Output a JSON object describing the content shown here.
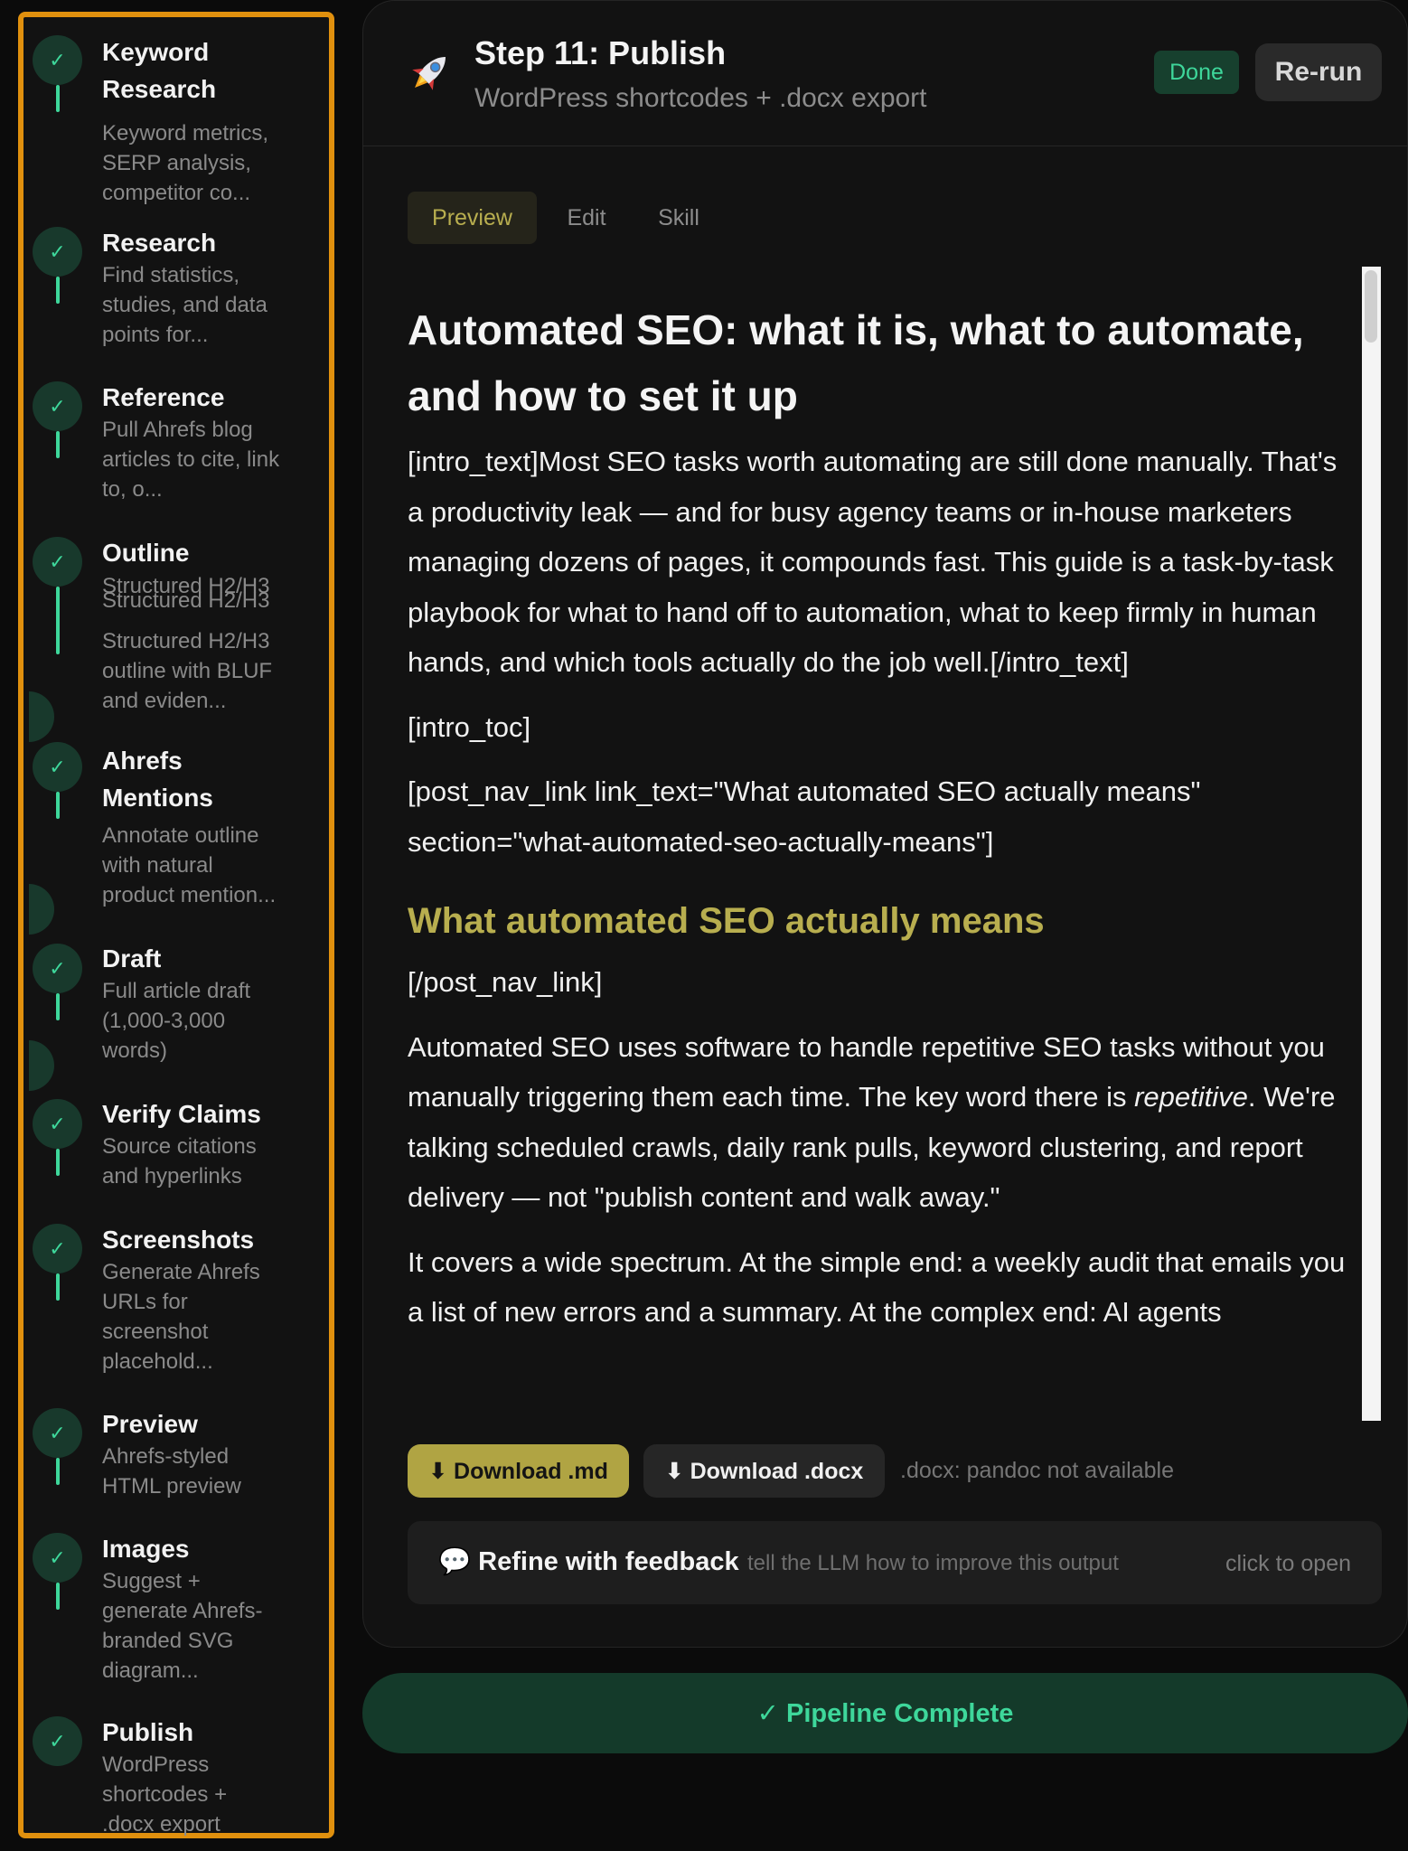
{
  "colors": {
    "accent_green": "#3ed79b",
    "accent_olive": "#b0a443",
    "sidebar_border": "#e0900e"
  },
  "sidebar": {
    "check_icon": "✓",
    "steps": [
      {
        "title_lines": [
          "Keyword",
          "Research"
        ],
        "desc_lines": [
          "Keyword metrics,",
          "SERP analysis,",
          "competitor co..."
        ]
      },
      {
        "title_lines": [
          "Research"
        ],
        "desc_lines": [
          "Find statistics,",
          "studies, and data",
          "points for..."
        ]
      },
      {
        "title_lines": [
          "Reference"
        ],
        "desc_lines": [
          "Pull Ahrefs blog",
          "articles to cite, link",
          "to, o..."
        ]
      },
      {
        "title_lines": [
          "Outline"
        ],
        "desc_lines": [
          "Structured H2/H3",
          "Structured H2/H3",
          "Structured H2/H3",
          "outline with BLUF",
          "and eviden..."
        ]
      },
      {
        "title_lines": [
          "Ahrefs",
          "Mentions"
        ],
        "desc_lines": [
          "Annotate outline",
          "with natural",
          "product mention..."
        ]
      },
      {
        "title_lines": [
          "Draft"
        ],
        "desc_lines": [
          "Full article draft",
          "(1,000-3,000",
          "words)"
        ]
      },
      {
        "title_lines": [
          "Verify Claims"
        ],
        "desc_lines": [
          "Source citations",
          "and hyperlinks"
        ]
      },
      {
        "title_lines": [
          "Screenshots"
        ],
        "desc_lines": [
          "Generate Ahrefs",
          "URLs for",
          "screenshot",
          "placehold..."
        ]
      },
      {
        "title_lines": [
          "Preview"
        ],
        "desc_lines": [
          "Ahrefs-styled",
          "HTML preview"
        ]
      },
      {
        "title_lines": [
          "Images"
        ],
        "desc_lines": [
          "Suggest +",
          "generate Ahrefs-",
          "branded SVG",
          "diagram..."
        ]
      },
      {
        "title_lines": [
          "Publish"
        ],
        "desc_lines": [
          "WordPress",
          "shortcodes +",
          ".docx export"
        ]
      }
    ]
  },
  "header": {
    "icon": "rocket-icon",
    "title": "Step 11: Publish",
    "subtitle": "WordPress shortcodes + .docx export",
    "status_badge": "Done",
    "rerun_label": "Re-run"
  },
  "tabs": {
    "preview": "Preview",
    "edit": "Edit",
    "skill": "Skill"
  },
  "preview": {
    "h1": "Automated SEO: what it is, what to automate, and how to set it up",
    "intro": "[intro_text]Most SEO tasks worth automating are still done manually. That's a productivity leak — and for busy agency teams or in-house marketers managing dozens of pages, it compounds fast. This guide is a task-by-task playbook for what to hand off to automation, what to keep firmly in human hands, and which tools actually do the job well.[/intro_text]",
    "toc": "[intro_toc]",
    "navlink": "[post_nav_link link_text=\"What automated SEO actually means\" section=\"what-automated-seo-actually-means\"]",
    "h2": "What automated SEO actually means",
    "navlink_close": "[/post_nav_link]",
    "para1_before": "Automated SEO uses software to handle repetitive SEO tasks without you manually triggering them each time. The key word there is ",
    "para1_em": "repetitive",
    "para1_after": ". We're talking scheduled crawls, daily rank pulls, keyword clustering, and report delivery — not \"publish content and walk away.\"",
    "para2": "It covers a wide spectrum. At the simple end: a weekly audit that emails you a list of new errors and a summary. At the complex end: AI agents"
  },
  "downloads": {
    "md_label": "⬇ Download .md",
    "docx_label": "⬇ Download .docx",
    "note": ".docx: pandoc not available"
  },
  "refine": {
    "title": "💬 Refine with feedback",
    "hint": "tell the LLM how to improve this output",
    "open": "click to open"
  },
  "pipeline_status": "✓ Pipeline Complete"
}
